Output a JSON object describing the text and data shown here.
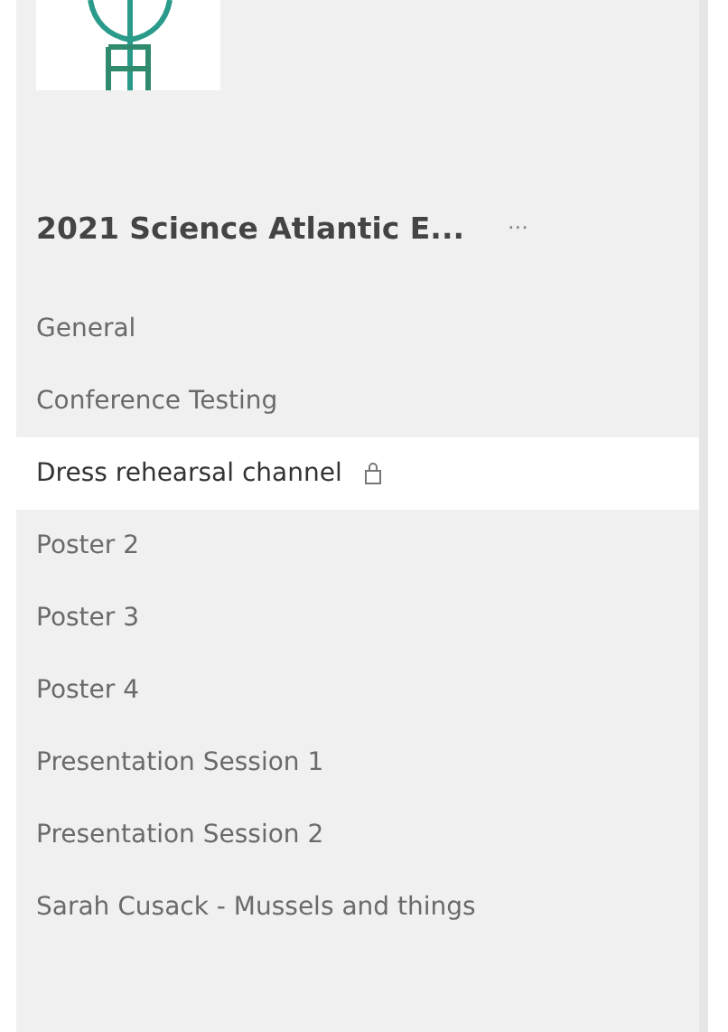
{
  "team": {
    "name": "2021 Science Atlantic E...",
    "more": "···"
  },
  "channels": [
    {
      "name": "General",
      "selected": false,
      "locked": false
    },
    {
      "name": "Conference Testing",
      "selected": false,
      "locked": false
    },
    {
      "name": "Dress rehearsal channel",
      "selected": true,
      "locked": true
    },
    {
      "name": "Poster 2",
      "selected": false,
      "locked": false
    },
    {
      "name": "Poster 3",
      "selected": false,
      "locked": false
    },
    {
      "name": "Poster 4",
      "selected": false,
      "locked": false
    },
    {
      "name": "Presentation Session 1",
      "selected": false,
      "locked": false
    },
    {
      "name": "Presentation Session 2",
      "selected": false,
      "locked": false
    },
    {
      "name": "Sarah Cusack - Mussels and things",
      "selected": false,
      "locked": false
    }
  ]
}
